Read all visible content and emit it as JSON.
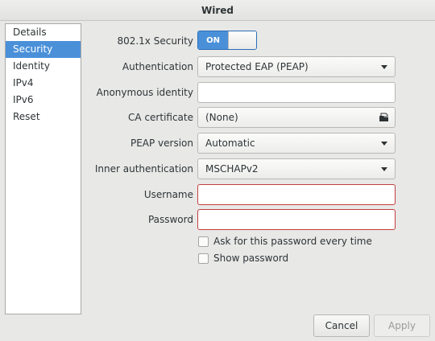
{
  "window": {
    "title": "Wired"
  },
  "sidebar": {
    "items": [
      {
        "label": "Details"
      },
      {
        "label": "Security"
      },
      {
        "label": "Identity"
      },
      {
        "label": "IPv4"
      },
      {
        "label": "IPv6"
      },
      {
        "label": "Reset"
      }
    ],
    "selected": "Security"
  },
  "form": {
    "security_8021x": {
      "label": "802.1x Security",
      "state": "ON"
    },
    "authentication": {
      "label": "Authentication",
      "value": "Protected EAP (PEAP)"
    },
    "anonymous_identity": {
      "label": "Anonymous identity",
      "value": ""
    },
    "ca_certificate": {
      "label": "CA certificate",
      "value": "(None)"
    },
    "peap_version": {
      "label": "PEAP version",
      "value": "Automatic"
    },
    "inner_auth": {
      "label": "Inner authentication",
      "value": "MSCHAPv2"
    },
    "username": {
      "label": "Username",
      "value": ""
    },
    "password": {
      "label": "Password",
      "value": ""
    },
    "ask_password": {
      "label": "Ask for this password every time",
      "checked": false
    },
    "show_password": {
      "label": "Show password",
      "checked": false
    }
  },
  "buttons": {
    "cancel": "Cancel",
    "apply": "Apply"
  },
  "colors": {
    "accent": "#4a90d9",
    "error": "#c33f3f"
  }
}
